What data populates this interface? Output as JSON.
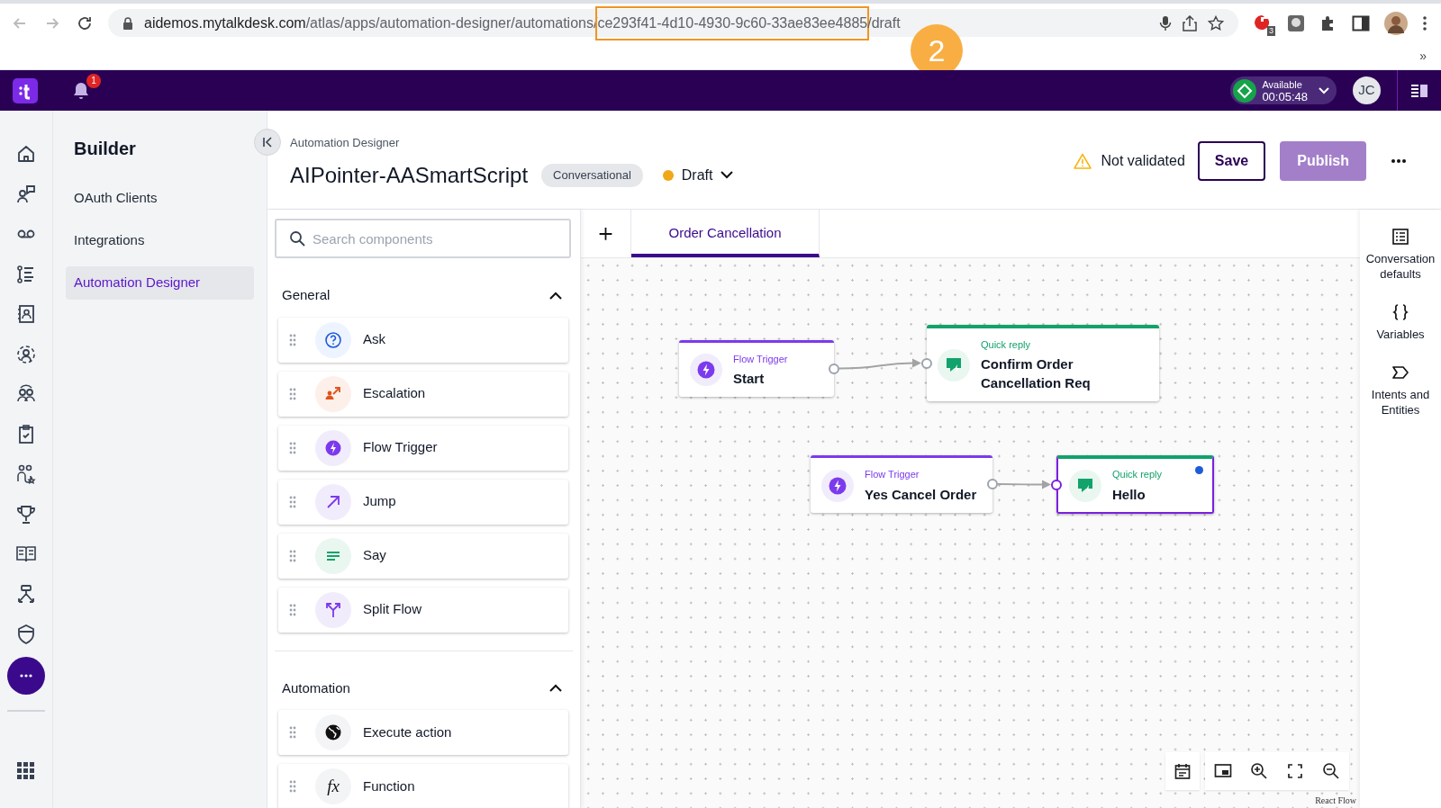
{
  "browser": {
    "url": [
      {
        "text": "aidemos.mytalkdesk.com",
        "kind": "host"
      },
      {
        "text": "/atlas/apps/automation-designer/automations/",
        "kind": "path"
      },
      {
        "text": "ce293f41-4d10-4930-9c60-33ae83ee4885",
        "kind": "highlight"
      },
      {
        "text": "/draft",
        "kind": "path"
      }
    ],
    "extension_badge": "3",
    "annotation_marker": "2",
    "overflow": "»"
  },
  "app_bar": {
    "notification_count": "1",
    "status": {
      "label": "Available",
      "timer": "00:05:48"
    },
    "avatar": "JC"
  },
  "builder": {
    "title": "Builder",
    "items": [
      {
        "label": "OAuth Clients",
        "selected": false
      },
      {
        "label": "Integrations",
        "selected": false
      },
      {
        "label": "Automation Designer",
        "selected": true
      }
    ]
  },
  "header": {
    "breadcrumb": "Automation Designer",
    "title": "AIPointer-AASmartScript",
    "type_badge": "Conversational",
    "status": "Draft",
    "validation": "Not validated",
    "buttons": [
      {
        "label": "Save",
        "kind": "outline",
        "disabled": false
      },
      {
        "label": "Publish",
        "kind": "primary",
        "disabled": true
      }
    ]
  },
  "components": {
    "search_placeholder": "Search components",
    "sections": [
      {
        "title": "General",
        "expanded": true,
        "items": [
          {
            "label": "Ask",
            "kind": "question"
          },
          {
            "label": "Escalation",
            "kind": "escalation"
          },
          {
            "label": "Flow Trigger",
            "kind": "bolt"
          },
          {
            "label": "Jump",
            "kind": "jump"
          },
          {
            "label": "Say",
            "kind": "say"
          },
          {
            "label": "Split Flow",
            "kind": "split"
          }
        ]
      },
      {
        "title": "Automation",
        "expanded": true,
        "items": [
          {
            "label": "Execute action",
            "kind": "globe"
          },
          {
            "label": "Function",
            "kind": "function",
            "glyph": "fx"
          }
        ]
      }
    ]
  },
  "tabs": [
    {
      "label": "Order Cancellation",
      "selected": true
    }
  ],
  "flows": [
    [
      {
        "type": "Flow Trigger",
        "kind": "trigger",
        "title": "Start",
        "selected": false,
        "modified": false
      },
      {
        "type": "Quick reply",
        "kind": "reply",
        "title": "Confirm Order Cancellation Req",
        "selected": false,
        "modified": false
      }
    ],
    [
      {
        "type": "Flow Trigger",
        "kind": "trigger",
        "title": "Yes Cancel Order",
        "selected": false,
        "modified": false
      },
      {
        "type": "Quick reply",
        "kind": "reply",
        "title": "Hello",
        "selected": true,
        "modified": true
      }
    ]
  ],
  "right_panel": [
    {
      "label": "Conversation defaults",
      "kind": "list"
    },
    {
      "label": "Variables",
      "kind": "braces"
    },
    {
      "label": "Intents and Entities",
      "kind": "tag"
    }
  ],
  "attribution": "React Flow"
}
